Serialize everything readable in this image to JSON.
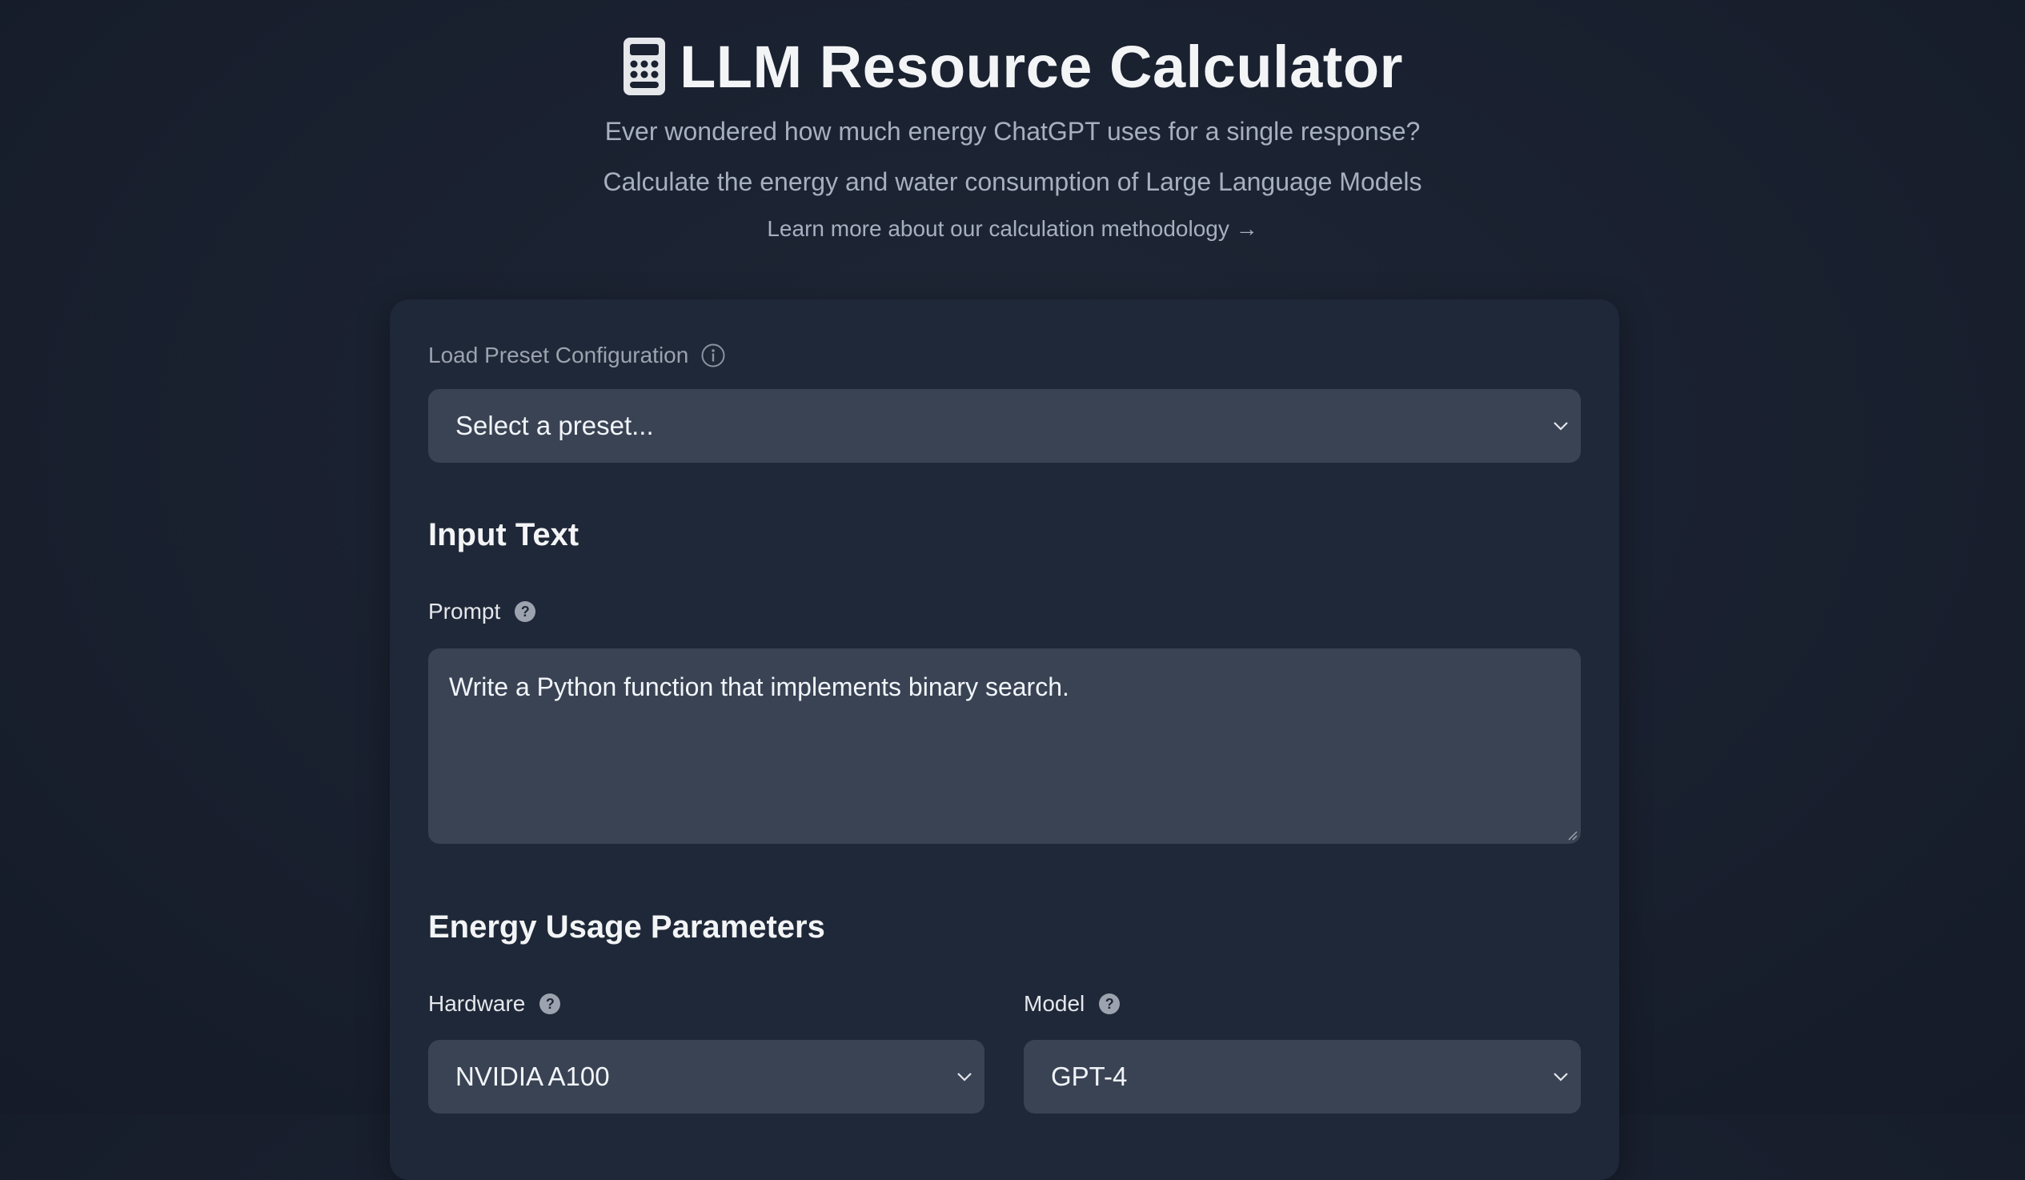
{
  "header": {
    "title_icon": "calculator-icon",
    "title": "LLM Resource Calculator",
    "subtitle_1": "Ever wondered how much energy ChatGPT uses for a single response?",
    "subtitle_2": "Calculate the energy and water consumption of Large Language Models",
    "methodology_link": "Learn more about our calculation methodology →"
  },
  "preset": {
    "label": "Load Preset Configuration",
    "info_icon": "info-icon",
    "selected": "Select a preset..."
  },
  "input_text": {
    "section_title": "Input Text",
    "prompt_label": "Prompt",
    "prompt_value": "Write a Python function that implements binary search."
  },
  "energy": {
    "section_title": "Energy Usage Parameters",
    "hardware_label": "Hardware",
    "hardware_selected": "NVIDIA A100",
    "model_label": "Model",
    "model_selected": "GPT-4"
  },
  "colors": {
    "background": "#1a2130",
    "card": "#1f2838",
    "input": "#3a4354",
    "text_primary": "#f1f5f9",
    "text_muted": "#a7b0bf"
  }
}
